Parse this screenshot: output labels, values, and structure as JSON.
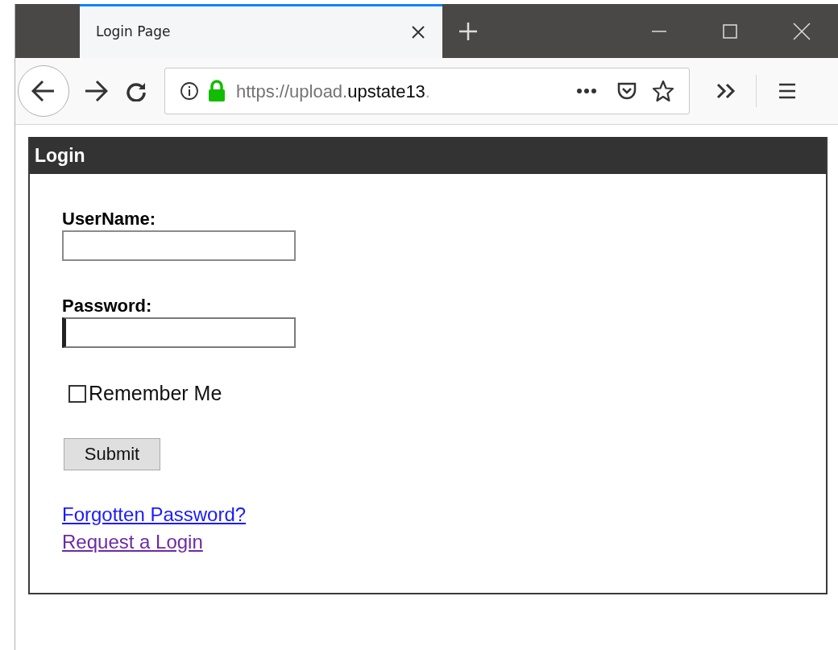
{
  "tab": {
    "title": "Login Page",
    "selected": true
  },
  "address_bar": {
    "url_start": "https://upload.",
    "url_domain": "upstate13",
    "url_end": "."
  },
  "panel": {
    "title": "Login"
  },
  "fields": [
    {
      "label": "UserName:",
      "focused": false
    },
    {
      "label": "Password:",
      "focused": true
    }
  ],
  "remember": {
    "label": "Remember Me",
    "checked": false
  },
  "submit": {
    "label": "Submit"
  },
  "links": [
    {
      "label": "Forgotten Password?",
      "visited": false
    },
    {
      "label": "Request a Login",
      "visited": true
    }
  ]
}
